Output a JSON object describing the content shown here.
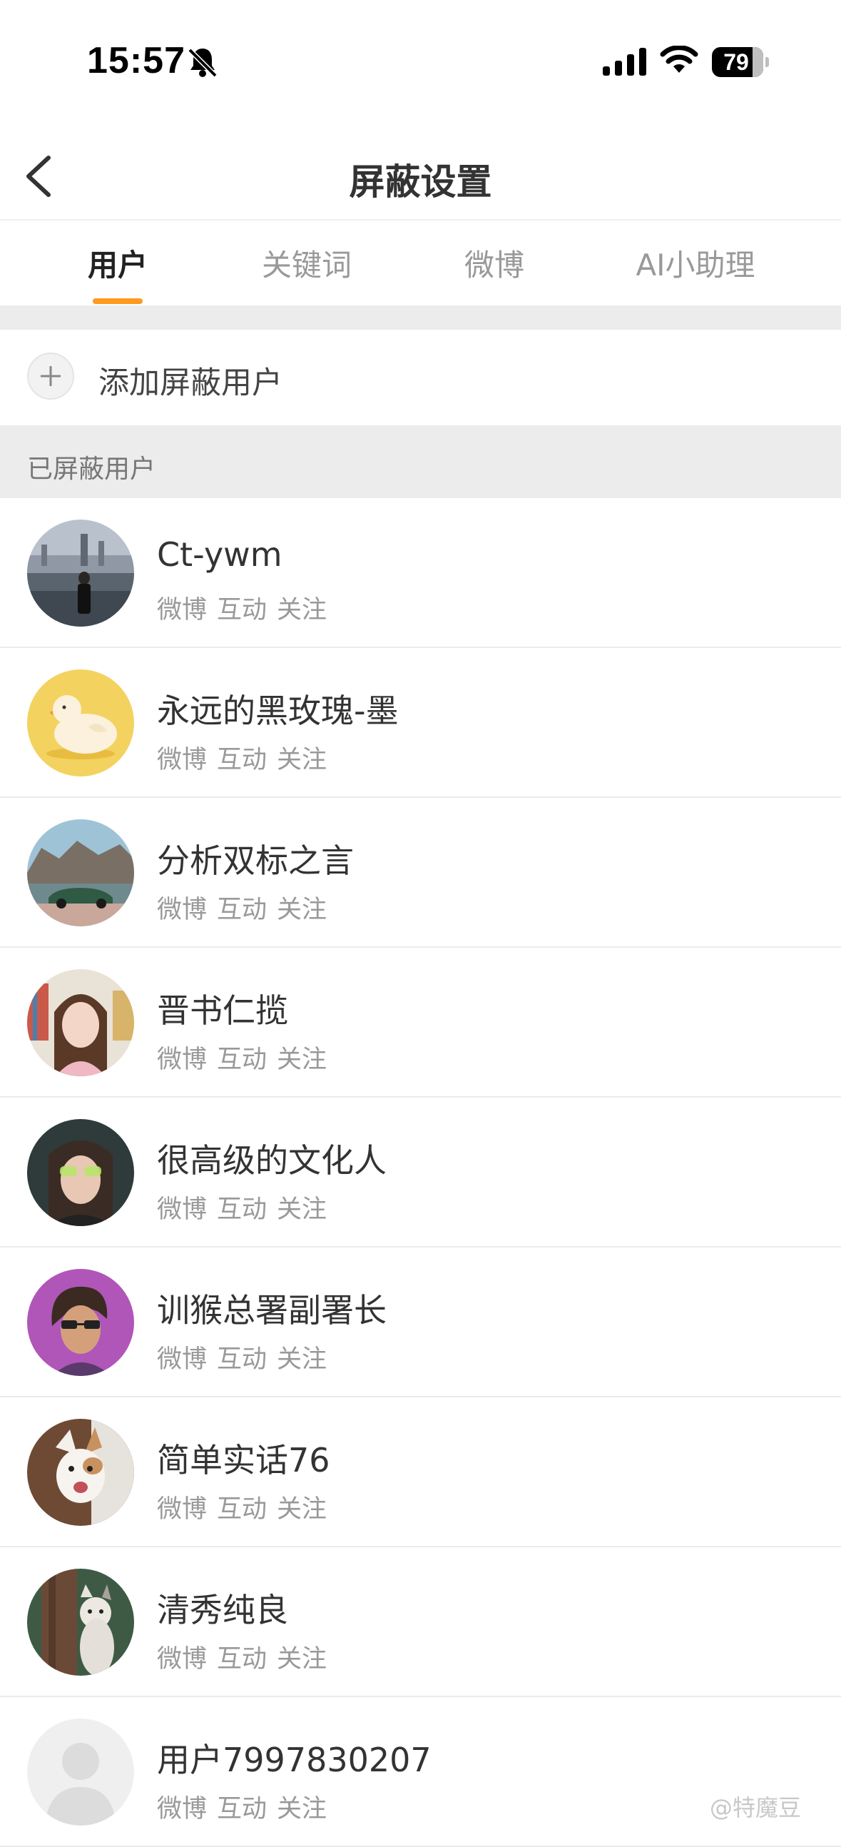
{
  "status_bar": {
    "time": "15:57",
    "battery": "79",
    "battery_level": 0.79
  },
  "header": {
    "title": "屏蔽设置",
    "back_icon": "chevron-left-icon"
  },
  "tabs": [
    {
      "label": "用户",
      "active": true
    },
    {
      "label": "关键词",
      "active": false
    },
    {
      "label": "微博",
      "active": false
    },
    {
      "label": "AI小助理",
      "active": false
    }
  ],
  "add_user": {
    "label": "添加屏蔽用户",
    "icon": "plus-icon"
  },
  "section": {
    "title": "已屏蔽用户"
  },
  "users": [
    {
      "name": "Ct-ywm",
      "actions": [
        "微博",
        "互动",
        "关注"
      ]
    },
    {
      "name": "永远的黑玫瑰-墨",
      "actions": [
        "微博",
        "互动",
        "关注"
      ]
    },
    {
      "name": "分析双标之言",
      "actions": [
        "微博",
        "互动",
        "关注"
      ]
    },
    {
      "name": "晋书仁揽",
      "actions": [
        "微博",
        "互动",
        "关注"
      ]
    },
    {
      "name": "很高级的文化人",
      "actions": [
        "微博",
        "互动",
        "关注"
      ]
    },
    {
      "name": "训猴总署副署长",
      "actions": [
        "微博",
        "互动",
        "关注"
      ]
    },
    {
      "name": "简单实话76",
      "actions": [
        "微博",
        "互动",
        "关注"
      ]
    },
    {
      "name": "清秀纯良",
      "actions": [
        "微博",
        "互动",
        "关注"
      ]
    },
    {
      "name": "用户7997830207",
      "actions": [
        "微博",
        "互动",
        "关注"
      ]
    }
  ],
  "watermark": "@特魔豆",
  "colors": {
    "accent": "#ff9a20",
    "band": "#ececec",
    "muted": "#999999"
  }
}
